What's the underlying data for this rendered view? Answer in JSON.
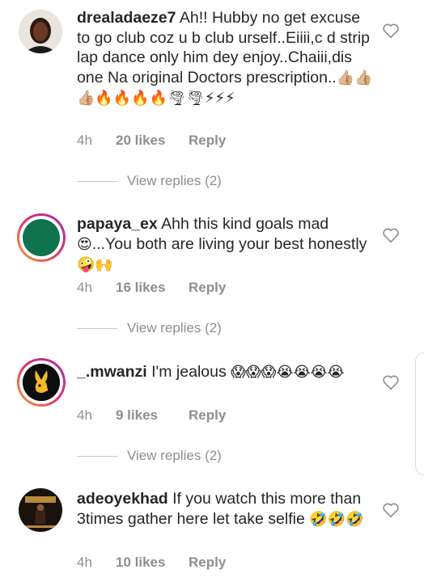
{
  "comments": [
    {
      "username": "drealadaeze7",
      "text": "Ah!! Hubby no get excuse to go club coz u b club urself..Eiiii,c d strip lap dance only him dey enjoy..Chaiii,dis one Na original Doctors prescription..",
      "emoji": "👍🏼👍🏼👍🏼🔥🔥🔥🔥🌪🌪⚡⚡⚡",
      "time": "4h",
      "likes": "20 likes",
      "reply": "Reply",
      "view_replies": "View replies (2)",
      "avatar_icon": "person-photo"
    },
    {
      "username": "papaya_ex",
      "text": "Ahh this kind goals mad",
      "emoji_mid": "😍",
      "text2": "...You both are living your best honestly",
      "emoji": "🤪🙌",
      "time": "4h",
      "likes": "16 likes",
      "reply": "Reply",
      "view_replies": "View replies (2)",
      "avatar_color": "#0f7350"
    },
    {
      "username": "_.mwanzi",
      "text": "I'm jealous",
      "emoji": "😱😱😱😭😭😭😭",
      "time": "4h",
      "likes": "9 likes",
      "reply": "Reply",
      "view_replies": "View replies (2)",
      "avatar_icon": "playboy-bunny-logo"
    },
    {
      "username": "adeoyekhad",
      "text": "If you watch this more than 3times gather here let take selfie",
      "emoji": "🤣🤣🤣",
      "time": "4h",
      "likes": "10 likes",
      "reply": "Reply",
      "avatar_icon": "event-poster"
    }
  ],
  "colors": {
    "muted": "#8e8e8e",
    "text": "#262626"
  }
}
